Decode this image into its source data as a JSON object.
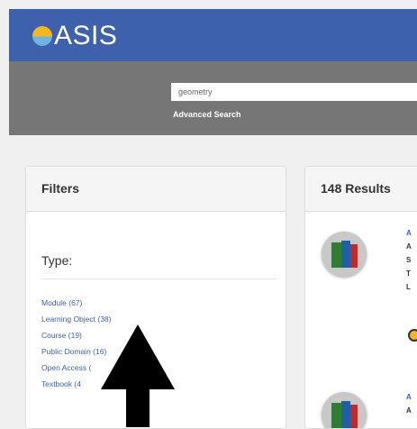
{
  "header": {
    "logo_text": "ASIS",
    "brand_color": "#3d61ad"
  },
  "search": {
    "value": "geometry",
    "advanced_label": "Advanced Search"
  },
  "filters": {
    "title": "Filters",
    "type_label": "Type:",
    "items": [
      {
        "label": "Module (67)"
      },
      {
        "label": "Learning Object (38)"
      },
      {
        "label": "Course (19)"
      },
      {
        "label": "Public Domain (16)"
      },
      {
        "label": "Open Access ("
      },
      {
        "label": "Textbook (4"
      }
    ]
  },
  "results": {
    "title": "148 Results"
  },
  "overlay": {
    "icon": "up-arrow-icon"
  }
}
